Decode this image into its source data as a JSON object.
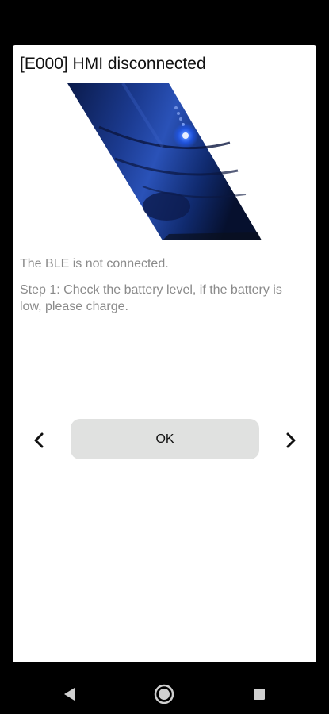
{
  "dialog": {
    "title": "[E000] HMI disconnected",
    "message": "The BLE is not connected.",
    "step": "Step 1: Check the battery level, if the battery is low, please charge.",
    "ok_label": "OK",
    "prev_icon": "chevron-left-icon",
    "next_icon": "chevron-right-icon"
  },
  "system_nav": {
    "back_icon": "back-triangle-icon",
    "home_icon": "home-circle-icon",
    "recents_icon": "recents-square-icon"
  },
  "colors": {
    "background": "#000000",
    "dialog": "#ffffff",
    "button": "#e0e1e0",
    "message_text": "#8a8a8a",
    "led": "#1e5bff"
  }
}
